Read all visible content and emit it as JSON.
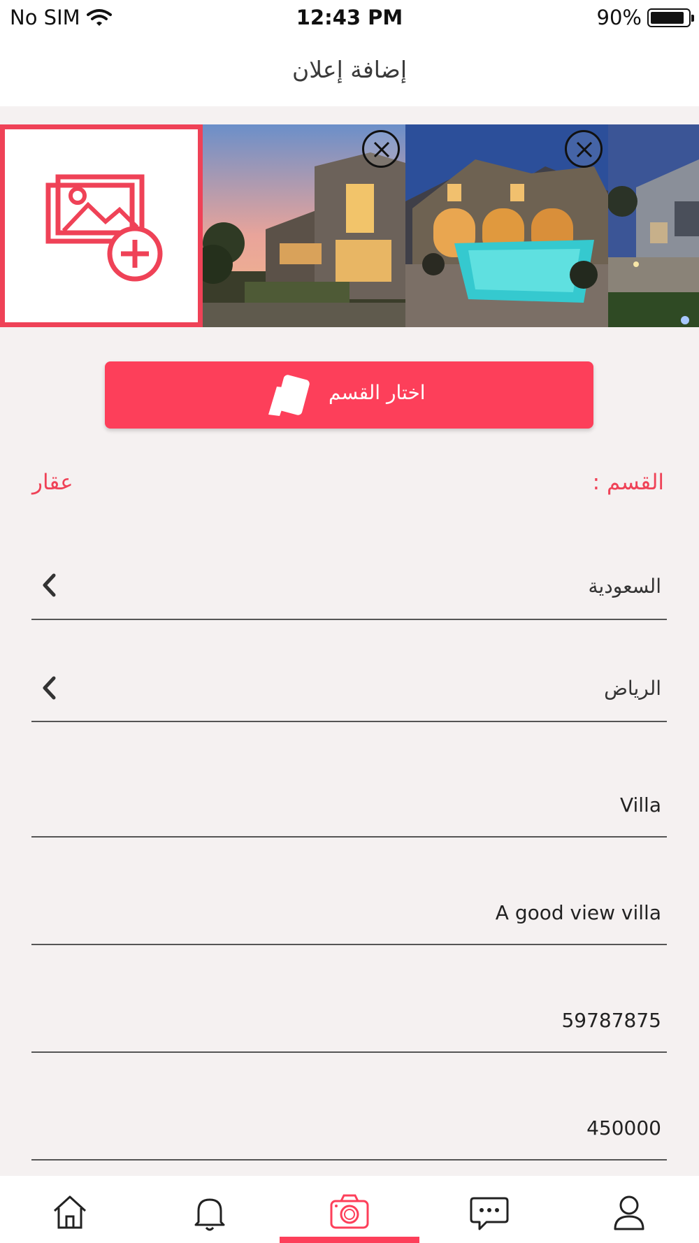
{
  "status_bar": {
    "carrier": "No SIM",
    "time": "12:43 PM",
    "battery": "90%",
    "battery_level": 0.9
  },
  "header": {
    "title": "إضافة إعلان"
  },
  "gallery": {
    "photos": [
      "sunset-house-photo",
      "pool-villa-photo",
      "night-house-photo"
    ]
  },
  "category_button": {
    "label": "اختار القسم"
  },
  "section": {
    "label": "القسم :",
    "value": "عقار"
  },
  "fields": {
    "country": "السعودية",
    "city": "الرياض",
    "title": "Villa",
    "description": "A good view villa",
    "phone": "59787875",
    "price": "450000"
  },
  "tab_bar": {
    "items": [
      "home-icon",
      "bell-icon",
      "camera-icon",
      "chat-icon",
      "profile-icon"
    ],
    "active": "camera-icon"
  },
  "colors": {
    "accent": "#fd3f5a",
    "background": "#f5f1f1"
  }
}
